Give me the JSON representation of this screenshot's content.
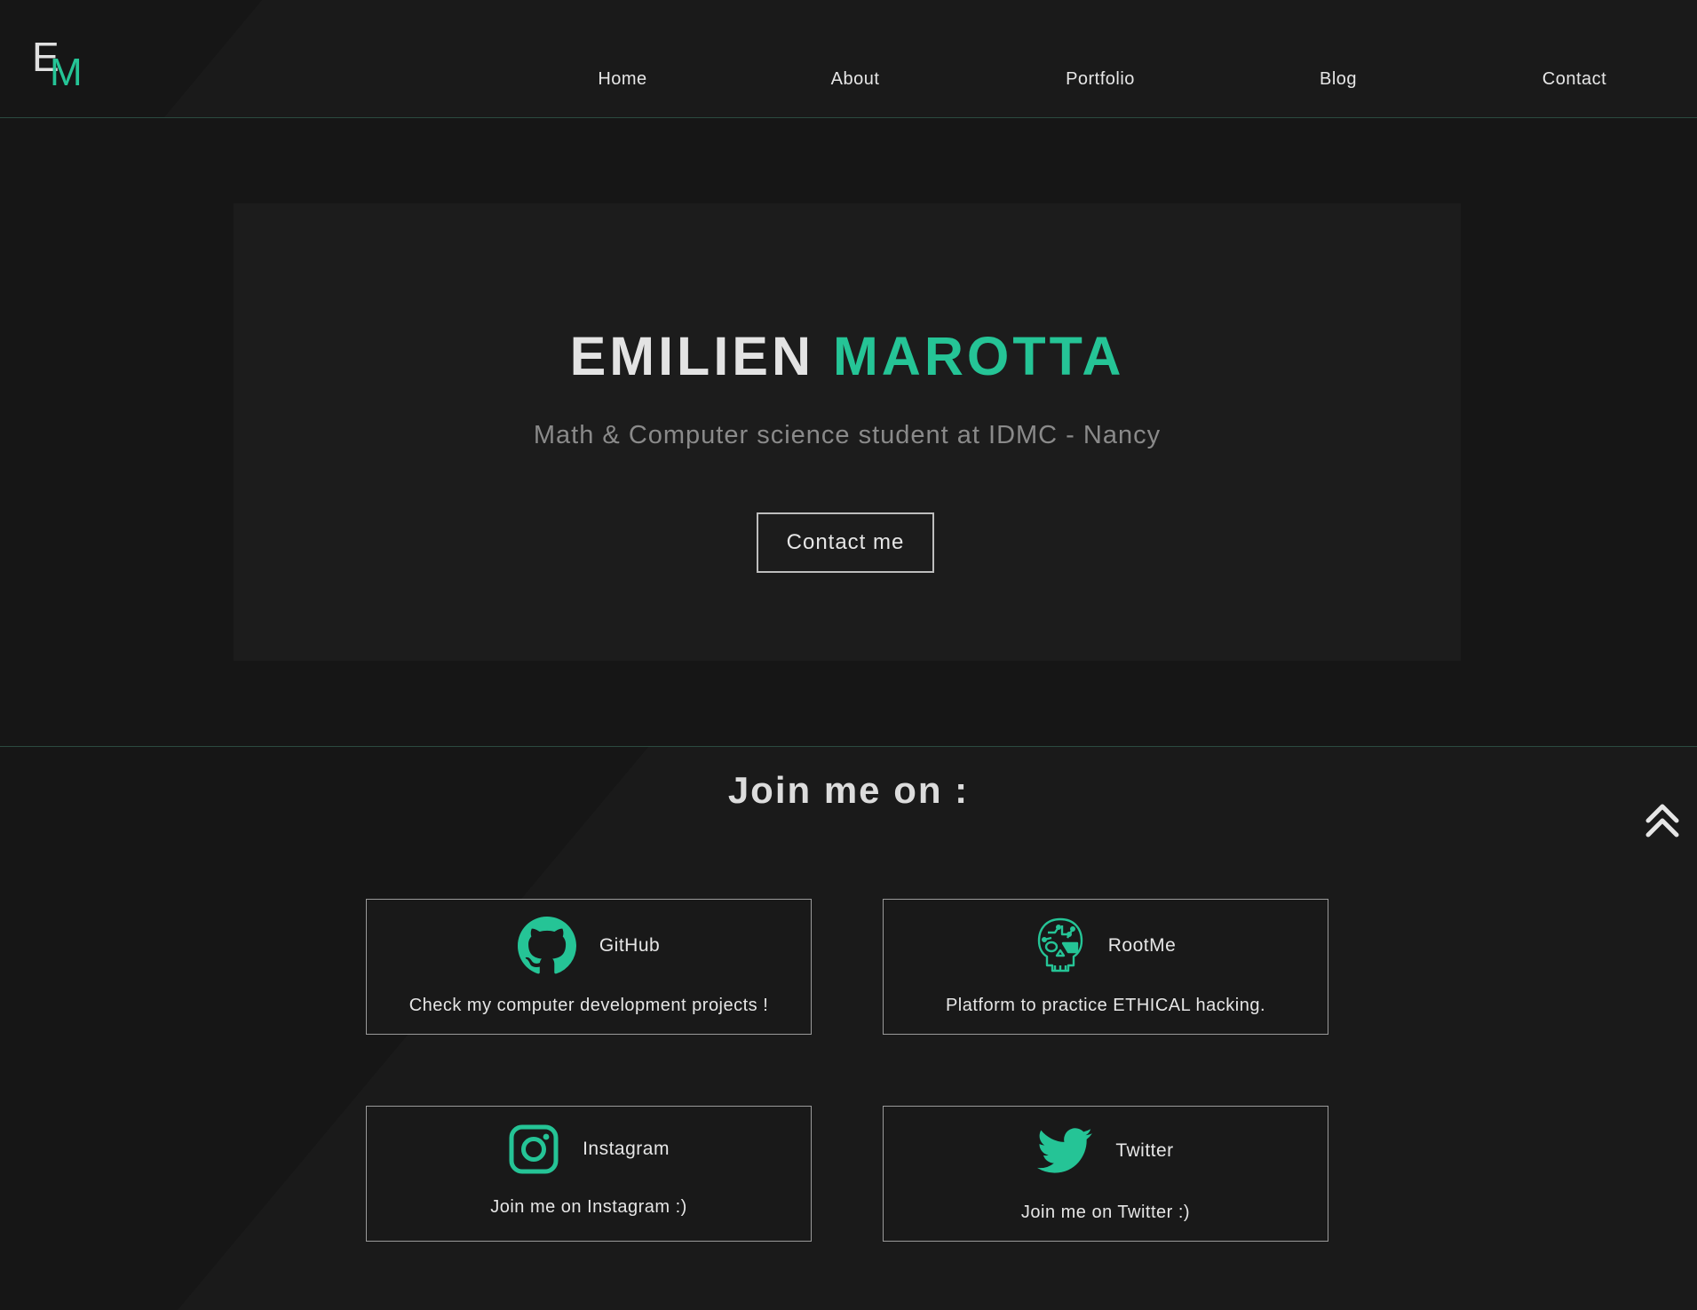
{
  "brand": {
    "logo_letters": [
      "E",
      "M"
    ],
    "accent_color": "#25c496",
    "background_color": "#181818"
  },
  "nav": {
    "items": [
      {
        "label": "Home"
      },
      {
        "label": "About"
      },
      {
        "label": "Portfolio"
      },
      {
        "label": "Blog"
      },
      {
        "label": "Contact"
      }
    ]
  },
  "hero": {
    "first_name": "EMILIEN",
    "last_name": "MAROTTA",
    "subtitle": "Math & Computer science student at IDMC - Nancy",
    "cta_label": "Contact me"
  },
  "join": {
    "title": "Join me on :",
    "cards": [
      {
        "name": "GitHub",
        "description": "Check my computer development projects !",
        "icon": "github-icon"
      },
      {
        "name": "RootMe",
        "description": "Platform to practice ETHICAL hacking.",
        "icon": "rootme-skull-icon"
      },
      {
        "name": "Instagram",
        "description": "Join me on Instagram :)",
        "icon": "instagram-icon"
      },
      {
        "name": "Twitter",
        "description": "Join me on Twitter :)",
        "icon": "twitter-icon"
      }
    ]
  },
  "scroll_top": {
    "icon": "double-chevron-up-icon"
  }
}
